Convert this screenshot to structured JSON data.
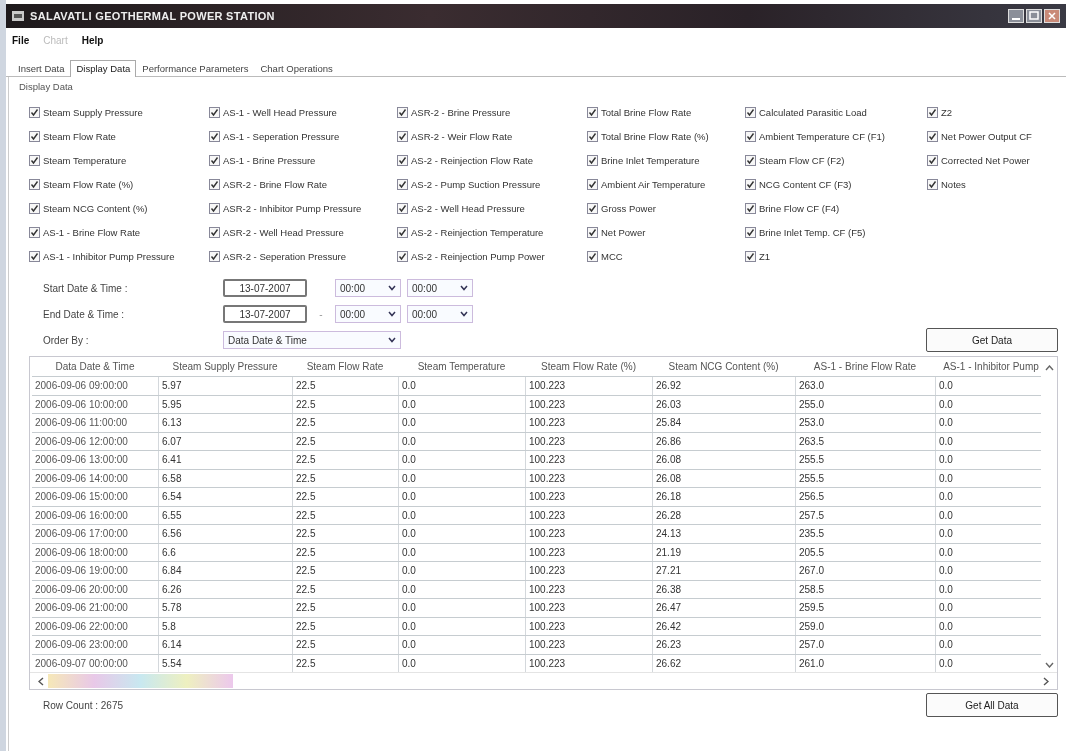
{
  "window": {
    "title": "SALAVATLI GEOTHERMAL POWER STATION"
  },
  "menu": [
    {
      "label": "File",
      "disabled": false
    },
    {
      "label": "Chart",
      "disabled": true
    },
    {
      "label": "Help",
      "disabled": false
    }
  ],
  "tabs": [
    {
      "label": "Insert Data",
      "selected": false
    },
    {
      "label": "Display Data",
      "selected": true
    },
    {
      "label": "Performance Parameters",
      "selected": false
    },
    {
      "label": "Chart Operations",
      "selected": false
    }
  ],
  "group_title": "Display Data",
  "columns_checks": [
    [
      {
        "label": "Steam Supply Pressure",
        "checked": true
      },
      {
        "label": "Steam Flow Rate",
        "checked": true
      },
      {
        "label": "Steam Temperature",
        "checked": true
      },
      {
        "label": "Steam Flow Rate (%)",
        "checked": true
      },
      {
        "label": "Steam NCG Content (%)",
        "checked": true
      },
      {
        "label": "AS-1 - Brine Flow Rate",
        "checked": true
      },
      {
        "label": "AS-1 - Inhibitor Pump Pressure",
        "checked": true
      }
    ],
    [
      {
        "label": "AS-1 - Well Head Pressure",
        "checked": true
      },
      {
        "label": "AS-1 - Seperation Pressure",
        "checked": true
      },
      {
        "label": "AS-1 - Brine Pressure",
        "checked": true
      },
      {
        "label": "ASR-2 - Brine Flow Rate",
        "checked": true
      },
      {
        "label": "ASR-2 - Inhibitor Pump Pressure",
        "checked": true
      },
      {
        "label": "ASR-2 - Well Head Pressure",
        "checked": true
      },
      {
        "label": "ASR-2 - Seperation Pressure",
        "checked": true
      }
    ],
    [
      {
        "label": "ASR-2 - Brine Pressure",
        "checked": true
      },
      {
        "label": "ASR-2 - Weir Flow Rate",
        "checked": true
      },
      {
        "label": "AS-2 - Reinjection Flow Rate",
        "checked": true
      },
      {
        "label": "AS-2 - Pump Suction Pressure",
        "checked": true
      },
      {
        "label": "AS-2 - Well Head Pressure",
        "checked": true
      },
      {
        "label": "AS-2 - Reinjection Temperature",
        "checked": true
      },
      {
        "label": "AS-2 - Reinjection Pump Power",
        "checked": true
      }
    ],
    [
      {
        "label": "Total Brine Flow Rate",
        "checked": true
      },
      {
        "label": "Total Brine Flow Rate (%)",
        "checked": true
      },
      {
        "label": "Brine Inlet Temperature",
        "checked": true
      },
      {
        "label": "Ambient Air Temperature",
        "checked": true
      },
      {
        "label": "Gross Power",
        "checked": true
      },
      {
        "label": "Net Power",
        "checked": true
      },
      {
        "label": "MCC",
        "checked": true
      }
    ],
    [
      {
        "label": "Calculated Parasitic Load",
        "checked": true
      },
      {
        "label": "Ambient Temperature CF (F1)",
        "checked": true
      },
      {
        "label": "Steam Flow CF (F2)",
        "checked": true
      },
      {
        "label": "NCG Content CF (F3)",
        "checked": true
      },
      {
        "label": "Brine Flow CF (F4)",
        "checked": true
      },
      {
        "label": "Brine Inlet Temp. CF (F5)",
        "checked": true
      },
      {
        "label": "Z1",
        "checked": true
      }
    ],
    [
      {
        "label": "Z2",
        "checked": true
      },
      {
        "label": "Net Power Output CF",
        "checked": true
      },
      {
        "label": "Corrected Net Power",
        "checked": true
      },
      {
        "label": "Notes",
        "checked": true
      }
    ]
  ],
  "filters": {
    "start_label": "Start Date & Time :",
    "start_date": "13-07-2007",
    "start_hour": "00:00",
    "start_minute": "00:00",
    "end_label": "End Date & Time :",
    "end_date": "13-07-2007",
    "end_separator": "-",
    "end_hour": "00:00",
    "end_minute": "00:00",
    "order_label": "Order By :",
    "order_value": "Data Date & Time"
  },
  "get_data_button": "Get Data",
  "table": {
    "columns": [
      "Data Date & Time",
      "Steam Supply Pressure",
      "Steam Flow Rate",
      "Steam Temperature",
      "Steam Flow Rate (%)",
      "Steam NCG Content (%)",
      "AS-1 - Brine Flow Rate",
      "AS-1 - Inhibitor Pump"
    ],
    "rows": [
      [
        "2006-09-06 09:00:00",
        "5.97",
        "22.5",
        "0.0",
        "100.223",
        "26.92",
        "263.0",
        "0.0"
      ],
      [
        "2006-09-06 10:00:00",
        "5.95",
        "22.5",
        "0.0",
        "100.223",
        "26.03",
        "255.0",
        "0.0"
      ],
      [
        "2006-09-06 11:00:00",
        "6.13",
        "22.5",
        "0.0",
        "100.223",
        "25.84",
        "253.0",
        "0.0"
      ],
      [
        "2006-09-06 12:00:00",
        "6.07",
        "22.5",
        "0.0",
        "100.223",
        "26.86",
        "263.5",
        "0.0"
      ],
      [
        "2006-09-06 13:00:00",
        "6.41",
        "22.5",
        "0.0",
        "100.223",
        "26.08",
        "255.5",
        "0.0"
      ],
      [
        "2006-09-06 14:00:00",
        "6.58",
        "22.5",
        "0.0",
        "100.223",
        "26.08",
        "255.5",
        "0.0"
      ],
      [
        "2006-09-06 15:00:00",
        "6.54",
        "22.5",
        "0.0",
        "100.223",
        "26.18",
        "256.5",
        "0.0"
      ],
      [
        "2006-09-06 16:00:00",
        "6.55",
        "22.5",
        "0.0",
        "100.223",
        "26.28",
        "257.5",
        "0.0"
      ],
      [
        "2006-09-06 17:00:00",
        "6.56",
        "22.5",
        "0.0",
        "100.223",
        "24.13",
        "235.5",
        "0.0"
      ],
      [
        "2006-09-06 18:00:00",
        "6.6",
        "22.5",
        "0.0",
        "100.223",
        "21.19",
        "205.5",
        "0.0"
      ],
      [
        "2006-09-06 19:00:00",
        "6.84",
        "22.5",
        "0.0",
        "100.223",
        "27.21",
        "267.0",
        "0.0"
      ],
      [
        "2006-09-06 20:00:00",
        "6.26",
        "22.5",
        "0.0",
        "100.223",
        "26.38",
        "258.5",
        "0.0"
      ],
      [
        "2006-09-06 21:00:00",
        "5.78",
        "22.5",
        "0.0",
        "100.223",
        "26.47",
        "259.5",
        "0.0"
      ],
      [
        "2006-09-06 22:00:00",
        "5.8",
        "22.5",
        "0.0",
        "100.223",
        "26.42",
        "259.0",
        "0.0"
      ],
      [
        "2006-09-06 23:00:00",
        "6.14",
        "22.5",
        "0.0",
        "100.223",
        "26.23",
        "257.0",
        "0.0"
      ],
      [
        "2006-09-07 00:00:00",
        "5.54",
        "22.5",
        "0.0",
        "100.223",
        "26.62",
        "261.0",
        "0.0"
      ]
    ]
  },
  "row_count": "Row Count : 2675",
  "get_all_data_button": "Get All Data"
}
